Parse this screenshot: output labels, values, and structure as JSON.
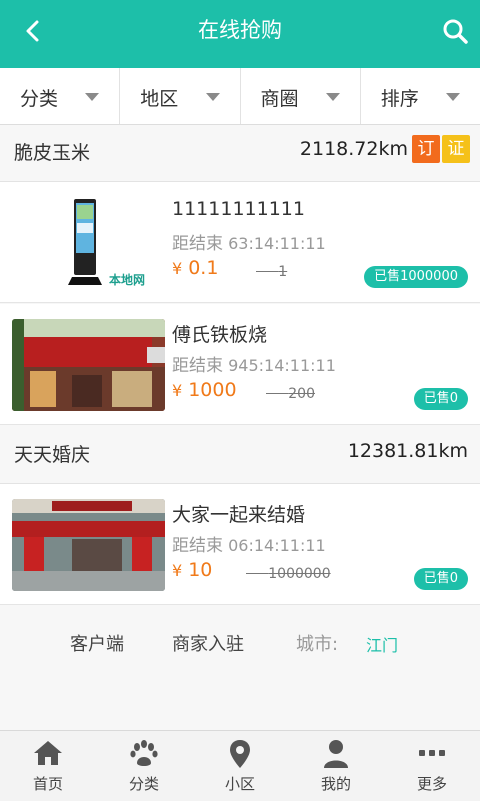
{
  "header": {
    "title": "在线抢购"
  },
  "filters": [
    {
      "label": "分类"
    },
    {
      "label": "地区"
    },
    {
      "label": "商圈"
    },
    {
      "label": "排序"
    }
  ],
  "shops": [
    {
      "name": "脆皮玉米",
      "distance": "2118.72km",
      "badges": [
        "订",
        "证"
      ],
      "items": [
        {
          "name": "11111111111",
          "end_label": "距结束",
          "end_time": "63:14:11:11",
          "currency": "¥",
          "price": "0.1",
          "original": "1",
          "sold": "已售1000000",
          "thumb_text": "本地网"
        },
        {
          "name": "傅氏铁板烧",
          "end_label": "距结束",
          "end_time": "945:14:11:11",
          "currency": "¥",
          "price": "1000",
          "original": "200",
          "sold": "已售0"
        }
      ]
    },
    {
      "name": "天天婚庆",
      "distance": "12381.81km",
      "items": [
        {
          "name": "大家一起来结婚",
          "end_label": "距结束",
          "end_time": "06:14:11:11",
          "currency": "¥",
          "price": "10",
          "original": "1000000",
          "sold": "已售0"
        }
      ]
    }
  ],
  "footer_links": {
    "client": "客户端",
    "merchant": "商家入驻",
    "city_label": "城市:",
    "city": "江门"
  },
  "tabs": [
    {
      "label": "首页",
      "icon": "home-icon"
    },
    {
      "label": "分类",
      "icon": "paw-icon"
    },
    {
      "label": "小区",
      "icon": "location-pin-icon"
    },
    {
      "label": "我的",
      "icon": "user-icon"
    },
    {
      "label": "更多",
      "icon": "more-dots-icon"
    }
  ],
  "colors": {
    "accent": "#1dbfa9",
    "price": "#f07a1a",
    "badge_order": "#f26b1d",
    "badge_cert": "#f5c11a"
  }
}
